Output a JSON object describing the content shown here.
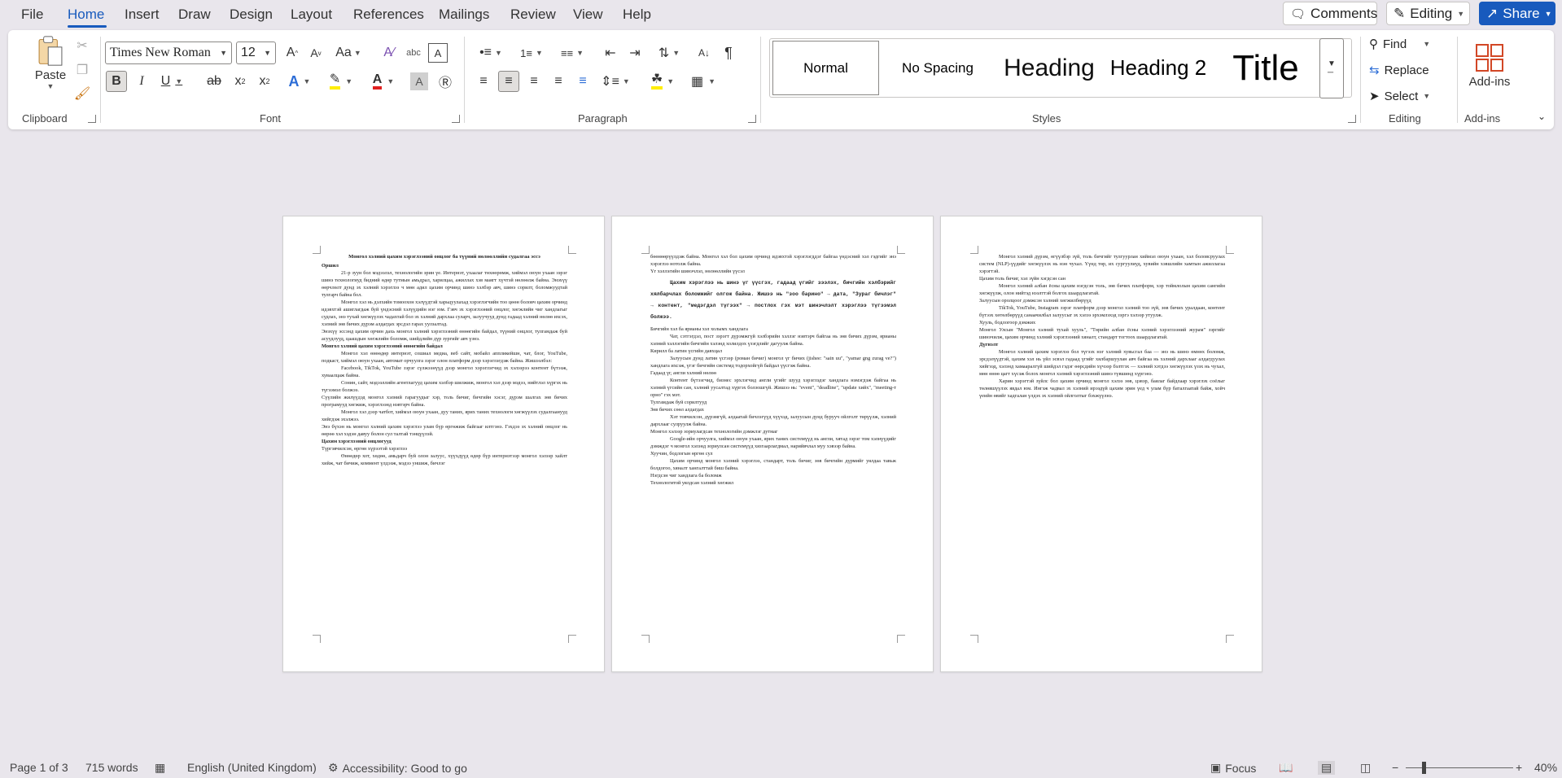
{
  "menu": {
    "items": [
      "File",
      "Home",
      "Insert",
      "Draw",
      "Design",
      "Layout",
      "References",
      "Mailings",
      "Review",
      "View",
      "Help"
    ],
    "active": "Home"
  },
  "top_buttons": {
    "comments": "Comments",
    "editing": "Editing",
    "share": "Share"
  },
  "ribbon": {
    "clipboard": {
      "label": "Clipboard",
      "paste": "Paste"
    },
    "font": {
      "label": "Font",
      "name": "Times New Roman",
      "size": "12",
      "change_case": "Aa"
    },
    "paragraph": {
      "label": "Paragraph"
    },
    "styles": {
      "label": "Styles",
      "items": [
        "Normal",
        "No Spacing",
        "Heading",
        "Heading 2",
        "Title"
      ]
    },
    "editing": {
      "label": "Editing",
      "find": "Find",
      "replace": "Replace",
      "select": "Select"
    },
    "addins": {
      "label": "Add-ins",
      "button": "Add-ins"
    }
  },
  "pages": [
    {
      "blocks": [
        {
          "t": "title",
          "text": "Монгол хэлний цахим хэрэглээний онцлог ба түүний нөлөөллийн судалгаа эссэ"
        },
        {
          "t": "hd",
          "text": "Оршил"
        },
        {
          "t": "ind",
          "text": "21-р зуун бол мэдээлэл, технологийн эрин үе. Интернэт, ухаалаг төхөөрөмж, хиймэл оюун ухаан зэрэг шинэ технологиуд бидний өдөр тутмын амьдрал, харилцаа, ажиллах хэв маягт хүчтэй нөлөөлж байна. Энэхүү өөрчлөлт дунд эх хэлний хэрэглээ ч мөн адил цахим орчинд шинэ хэлбэр авч, шинэ сорилт, боломжуудтай тулгарч байна бол."
        },
        {
          "t": "ind",
          "text": "Монгол хэл нь дэлхийн томоохон хэлүүдтэй харьцуулахад хэрэглэгчийн тоо цөөн боловч цахим орчинд идэвхтэй ашиглагдаж буй үндэсний хэлүүдийн нэг юм. Гэвч эх хэрэглээний онцлог, хөгжлийн чиг хандлагыг судлах, энэ тухай хөгжүүлэх чадахтай бол эх хэлний дархлаа суларч, залуучууд дунд гадаад хэлний нөлөө ихсэх, хэлний зөв бичих дүрэм алдагдах эрсдэл гарах уулзалтад."
        },
        {
          "t": "p",
          "text": "Энэхүү эссэнд цахим орчин дахь монгол хэлний хэрэглээний өнөөгийн байдал, түүний онцлог, тулгамдаж буй асуудлууд, цаашдын хөгжлийн боломж, шийдлийн дүр зургийг авч үзнэ."
        },
        {
          "t": "hd",
          "text": "Монгол хэлний цахим хэрэглээний өнөөгийн байдал"
        },
        {
          "t": "ind",
          "text": "Монгол хэл өнөөдөр интернэт, сошиал медиа, веб сайт, мобайл аппликейшн, чат, блог, YouTube, подкаст, хиймэл оюун ухаан, автомат орчуулга зэрэг олон платформ дээр хэрэглэгдэж байна. Жишээлбэл:"
        },
        {
          "t": "ind",
          "text": "Facebook, TikTok, YouTube зэрэг сүлжээнүүд дээр монгол хэрэглэгчид эх хэлээрээ контент бүтээж, хуваалцаж байна."
        },
        {
          "t": "ind",
          "text": "Сонин, сайт, мэдээллийн агентлагууд цахим хэлбэр шилжиж, монгол хэл дээр мэдээ, нийтлэл хүргэх нь түгээмэл болжээ."
        },
        {
          "t": "p",
          "text": "Сүүлийн жилүүдэд монгол хэлний гарагуудыг хэр, толь бичиг, бичгийн хэсэг, дүрэм шалгах зөв бичих програмууд хөгжиж, хэрэглээнд нэвтэрч байна."
        },
        {
          "t": "ind",
          "text": "Монгол хэл дээр чатбот, хиймэл оюун ухаан, дуу таних, ярих таних технологи хөгжүүлэх судалгаанууд хийгдэж эхэлжээ."
        },
        {
          "t": "p",
          "text": "Энэ бүхэн нь монгол хэлний цахим хэрэглээ улам бүр өргөжиж байгааг илтгэнэ. Гэхдээ эх хэлний онцлог нь өөрөө хэл хэдэн давуу болон сул талтай тэнцүүлэй."
        },
        {
          "t": "hd",
          "text": "Цахим хэрэглээний онцлогууд"
        },
        {
          "t": "p",
          "text": "Түргэвчилсэн, өргөн хүрээтэй хэрэглээ"
        },
        {
          "t": "ind",
          "text": "Өнөөдөр хот, хөдөө, амьдарч буй олон залуус, хүүхдүүд өдөр бүр интернэтээр монгол хэлээр хайлт хийж, чат бичиж, коммент үлдээж, мэдээ уншиж, бичлэг"
        }
      ]
    },
    {
      "blocks": [
        {
          "t": "p",
          "text": "бөөнөөрүүлдэж байна. Монгол хэл бол цахим орчинд идэвхтэй хэрэглэгддэг байгаа үндэсний хэл гэдгийг энэ хэрэглээ нотолж байна."
        },
        {
          "t": "p",
          "text": "Үг хэллэгийн шинэчлэл, нөлөөллийн үүсэл"
        },
        {
          "t": "mono",
          "text": "Цахим хэрэглээ нь шинэ үг үүсгэх, гадаад үгийг зээлэх, бичгийн хэлбэрийг хялбарчлах боломжийг олгож байна. Жишээ нь \"зоо барино\" → дата, \"Зураг бичлэг\" → контент, \"медэгдэл түгээх\" → постлох гэх мэт шинэчлэлт хэрэглээ түгээмэл болжээ."
        },
        {
          "t": "p",
          "text": "Бичгийн хэл ба ярианы хэл холымх хандлага"
        },
        {
          "t": "ind",
          "text": "Чат, сэтгэгдэл, пост зэрэгт дүрэмжгүй хэлбэрийн хэллэг нэвтэрч байгаа нь зөв бичих дүрэм, ярианы хэлний хэллэгийн бичгийн хэлэнд холилдох үзэгдлийг дагуулж байна."
        },
        {
          "t": "p",
          "text": "Кирилл ба латин үсгийн давхцал"
        },
        {
          "t": "ind",
          "text": "Залуусын дунд латин үсгээр (роман бичиг) монгол үг бичих (jishee: \"sain uu\", \"yamar gng zurag ve?\") хандлага ихсэж, үгэг бичгийн системд тодорхойгүй байдал үүсгэж байна."
        },
        {
          "t": "p",
          "text": "Гадаад үг, англи хэлний нөлөө"
        },
        {
          "t": "ind",
          "text": "Контент бүтээгчид, бизнес эрхлэгчид англи үгийг шууд хэрэглэдэг хандлага нэмэгдэж байгаа нь хэлний үгсийн сан, хэлний уусалтад хүргэх болзошгүй. Жишээ нь: \"event\", \"deadline\", \"update хийх\", \"meeting-т орно\" гэх мэт."
        },
        {
          "t": "p",
          "text": "Тулгамдаж буй сорилтууд"
        },
        {
          "t": "p",
          "text": "Зөв бичих сөөл алдагдах"
        },
        {
          "t": "ind",
          "text": "Хэт товчилсон, дүрэмгүй, алдаатай бичлэгүүд хүүхэд, залуусын дунд бурууч ойлголт төрүүлж, хэлний дархлааг сулруулж байна."
        },
        {
          "t": "p",
          "text": "Монгол хэлээр зориулагдсан технологийн дэмжлэг дутмаг"
        },
        {
          "t": "ind",
          "text": "Google-ийн орчуулга, хиймэл оюун ухаан, ярих таних системүүд нь англи, хятад зэрэг том хэлнүүдийг дэмждэг ч монгол хэлэнд зориулсан системүүд хязгаарлагдмал, нарийвчлал муу хэвээр байна."
        },
        {
          "t": "p",
          "text": "Хуучин, бодлогын өргөн сул"
        },
        {
          "t": "ind",
          "text": "Цахим орчинд монгол хэлний хэрэглээ, стандарт, толь бичиг, зөв бичгийн дүрмийг уялдаа тавьж болдогоо, хяналт хангалттай биш байна."
        },
        {
          "t": "p",
          "text": "Нэгдсэн чиг хандлага ба боломж"
        },
        {
          "t": "p",
          "text": "Технологитой уялдсан хэлний хөгжил"
        }
      ]
    },
    {
      "blocks": [
        {
          "t": "ind",
          "text": "Монгол хэлний дүрэм, өгүүлбэр зүй, толь бичгийг тулгуурлан хиймэл оюун ухаан, хэл боловсруулах систем (NLP)-үүдийг хөгжүүлэх нь нэн чухал. Үүнд төр, их сургуулиуд, хувийн хэвшлийн хамтын ажиллагаа хэрэгтэй."
        },
        {
          "t": "p",
          "text": "Цахим толь бичиг, хэл зүйн хэгдсэн сан"
        },
        {
          "t": "ind",
          "text": "Монгол хэлний албан ёсны цахим нэгдсэн толь, зөв бичих платформ, хэр тоймлолын цахим сангийн хөгжүүлж, олон нийтэд нээлттэй болгох шаардлагатай."
        },
        {
          "t": "p",
          "text": "Залуусын оролцоог дэмжсэн хэлний хөгжилбөрүүд"
        },
        {
          "t": "ind",
          "text": "TikTok, YouTube, Instagram зэрэг платформ дээр монгол хэлний тоо зүй, зөв бичих уралдаан, контент бүтээх хөтөлбөрүүд санаачилбал залуусыг эх хэлээ эрхэмлэхэд зэргэ хэлээр утуулж."
        },
        {
          "t": "p",
          "text": "Хууль, бодлогоор дэмжих"
        },
        {
          "t": "p",
          "text": "Монгол Улсын \"Монгол хэлний тухай хууль\", \"Төрийн албан ёсны хэлний хэрэглээний журам\" зэргийг шинэчилж, цахим орчинд хэлний хэрэглээний хяналт, стандарт тогтоох шаардлагатай."
        },
        {
          "t": "hd",
          "text": "Дүгнэлт"
        },
        {
          "t": "ind",
          "text": "Монгол хэлний цахим хэрэглээ бол түгээх нэг хэлний хувьсгал баа — энэ нь шинэ өмнөх боломж, эрсдэлүүдтэй, цахим хэл нь үйл эсвэл гадаад үгийг хялбаршуулан авч байгаа нь хэлний дархлааг алдагдуулах хийгээд, хэлэнд хамааралгүй шийдэл гэдэг өөрсдийн хүчээр бэлтгэх — хэлний хэтдээ хөгжүүлэх үзэх нь чухал, мөн өнөө цагт хүсэж болох монгол хэлний хэрэглээний шинэ түвшинд хүргэнэ."
        },
        {
          "t": "ind",
          "text": "Харин хэрэгтэй зүйлс бол цахим орчинд монгол хэлээ зөв, цэвэр, баялаг байдлаар хэрэглэх соёлыг төлөвшүүлэх явдал юм. Ингэж чадвал эх хэлний ирээдүй цахим эрин үед ч улам бүр баталгаатай байж, хойч үеийн өвийг хадгалан үлдэх эх хэлний ойлголтыг бэхжүүлнэ."
        }
      ]
    }
  ],
  "status": {
    "page": "Page 1 of 3",
    "words": "715 words",
    "language": "English (United Kingdom)",
    "accessibility": "Accessibility: Good to go",
    "focus": "Focus",
    "zoom": "40%"
  }
}
